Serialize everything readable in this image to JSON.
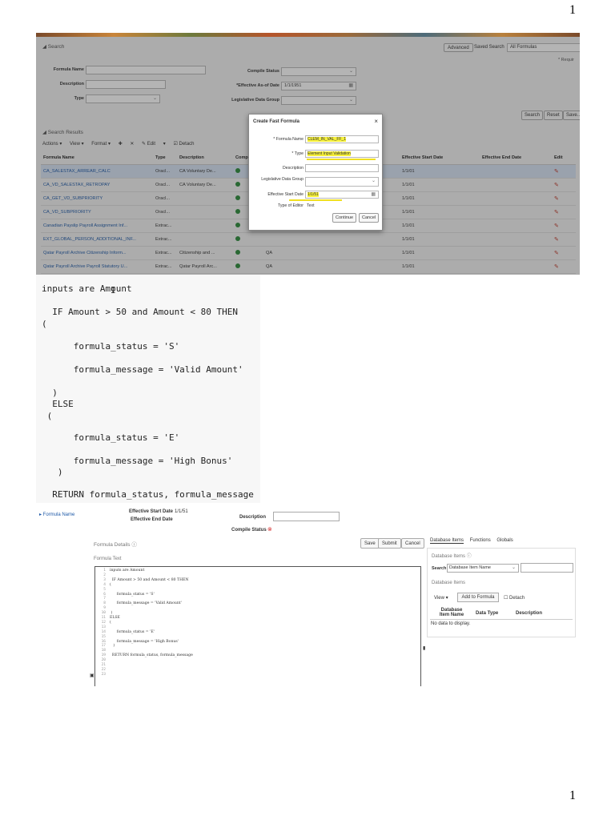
{
  "page_numbers": {
    "top": "1",
    "bottom": "1"
  },
  "shot1": {
    "search_title": "◢ Search",
    "advanced_btn": "Advanced",
    "saved_search_label": "Saved Search",
    "saved_search_value": "All Formulas",
    "required_note": "* Requir",
    "labels": {
      "formula_name": "Formula Name",
      "description": "Description",
      "type": "Type",
      "compile_status": "Compile Status",
      "effective_as_of_date": "*Effective As-of Date",
      "legislative_data_group": "Legislative Data Group"
    },
    "effective_date_value": "1/1/1951",
    "buttons": {
      "search": "Search",
      "reset": "Reset",
      "save": "Save..."
    },
    "search_results_title": "◢ Search Results",
    "toolbar": [
      "Actions ▾",
      "View ▾",
      "Format ▾",
      "✚",
      "✕",
      "✎ Edit",
      "▾",
      "☑ Detach"
    ],
    "columns": [
      "Formula Name",
      "Type",
      "Description",
      "Compil",
      "",
      "Effective Start Date",
      "Effective End Date",
      "Edit"
    ],
    "rows": [
      {
        "name": "CA_SALESTAX_ARREAR_CALC",
        "type": "Oracl...",
        "desc": "CA Voluntary De...",
        "ok": true,
        "extra": "",
        "start": "1/1/01"
      },
      {
        "name": "CA_VD_SALESTAX_RETROPAY",
        "type": "Oracl...",
        "desc": "CA Voluntary De...",
        "ok": true,
        "extra": "",
        "start": "1/1/01"
      },
      {
        "name": "CA_GET_VD_SUBPRIORITY",
        "type": "Oracl...",
        "desc": "",
        "ok": true,
        "extra": "",
        "start": "1/1/01"
      },
      {
        "name": "CA_VD_SUBPRIORITY",
        "type": "Oracl...",
        "desc": "",
        "ok": true,
        "extra": "",
        "start": "1/1/01"
      },
      {
        "name": "Canadian Payslip Payroll Assignment Inf...",
        "type": "Extrac...",
        "desc": "",
        "ok": true,
        "extra": "QA",
        "start": "1/1/01"
      },
      {
        "name": "EXT_GLOBAL_PERSON_ADDITIONAL_INF...",
        "type": "Extrac...",
        "desc": "",
        "ok": true,
        "extra": "",
        "start": "1/1/01"
      },
      {
        "name": "Qatar Payroll Archive Citizenship Inform...",
        "type": "Extrac...",
        "desc": "Citizenship and ...",
        "ok": true,
        "extra": "QA",
        "start": "1/1/01"
      },
      {
        "name": "Qatar Payroll Archive Payroll Statutory U...",
        "type": "Extrac...",
        "desc": "Qatar Payroll Arc...",
        "ok": true,
        "extra": "QA",
        "start": "1/1/01"
      }
    ],
    "modal": {
      "title": "Create Fast Formula",
      "close": "×",
      "labels": {
        "formula_name": "* Formula Name",
        "type": "* Type",
        "description": "Description",
        "ldg": "Legislative Data Group",
        "start_date": "Effective Start Date",
        "editor_type": "Type of Editor"
      },
      "values": {
        "formula_name": "CLEM_IN_VAL_FF_1",
        "type": "Element Input Validation",
        "start_date": "1/1/51",
        "editor_type": "Text"
      },
      "continue_btn": "Continue",
      "cancel_btn": "Cancel"
    }
  },
  "shot2": {
    "lines": [
      "inputs are Amount",
      "  IF Amount > 50 and Amount < 80 THEN",
      "(",
      "      formula_status = 'S'",
      "      formula_message = 'Valid Amount'",
      "  )",
      "  ELSE",
      " (",
      "      formula_status = 'E'",
      "      formula_message = 'High Bonus'",
      "   )",
      "  RETURN formula_status, formula_message"
    ]
  },
  "shot3": {
    "formula_name_label": "▸ Formula Name",
    "eff_start_label": "Effective Start Date",
    "eff_start_value": "1/1/51",
    "eff_end_label": "Effective End Date",
    "description_label": "Description",
    "compile_status_label": "Compile Status",
    "compile_status_icon": "⊗",
    "formula_details": "Formula Details ⓘ",
    "formula_text": "Formula Text",
    "save_btn": "Save",
    "submit_btn": "Submit",
    "cancel_btn": "Cancel",
    "tabs": [
      "Database Items",
      "Functions",
      "Globals"
    ],
    "db_items_title": "Database Items ⓘ",
    "search_label": "Search",
    "search_value": "Database Item Name",
    "db_items_sub": "Database Items",
    "view_btn": "View ▾",
    "add_to_formula_btn": "Add to Formula",
    "detach": "☐ Detach",
    "col_db_item_name": "Database Item Name",
    "col_data_type": "Data Type",
    "col_description": "Description",
    "no_data": "No data to display.",
    "code_lines": [
      "inputs are Amount",
      "",
      "  IF Amount > 50 and Amount < 80 THEN",
      "(",
      "",
      "      formula_status = 'S'",
      "",
      "      formula_message = 'Valid Amount'",
      "",
      " )",
      "ELSE",
      "(",
      "",
      "      formula_status = 'E'",
      "",
      "      formula_message = 'High Bonus'",
      "   )",
      "",
      "  RETURN formula_status, formula_message",
      "",
      "",
      "",
      ""
    ]
  }
}
